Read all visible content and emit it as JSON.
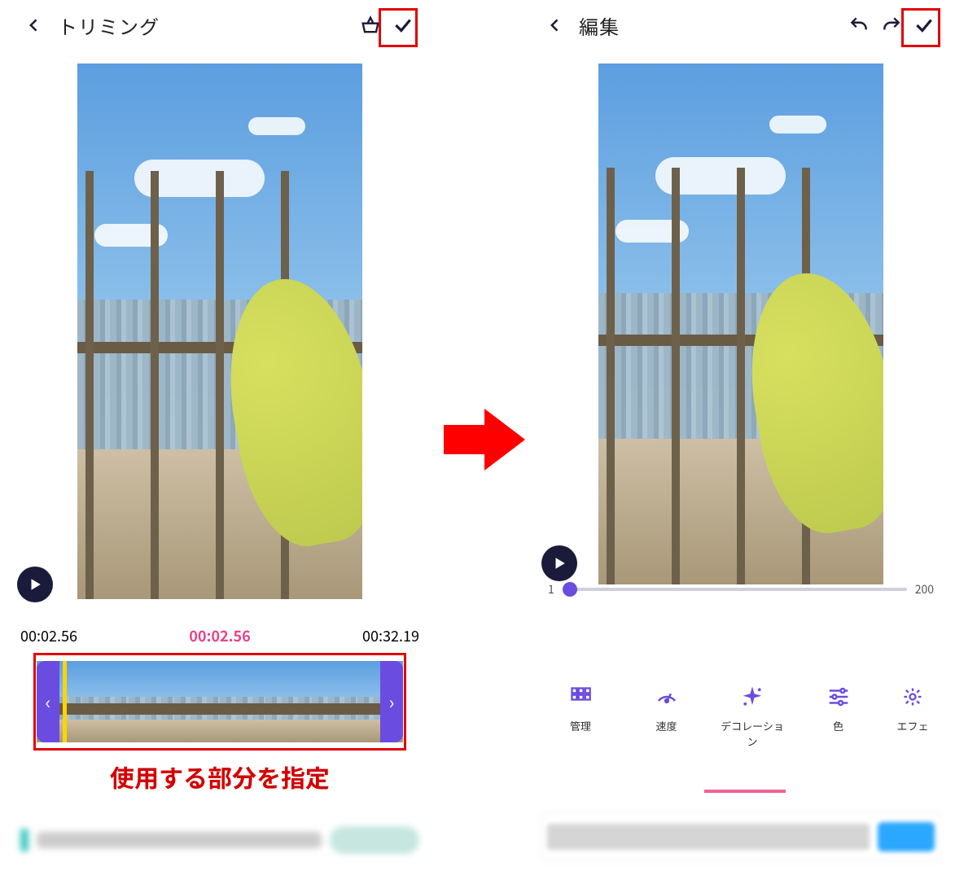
{
  "left": {
    "title": "トリミング",
    "time_start": "00:02.56",
    "time_mid": "00:02.56",
    "time_end": "00:32.19",
    "caption": "使用する部分を指定"
  },
  "right": {
    "title": "編集",
    "slider_min": "1",
    "slider_max": "200",
    "tools": [
      {
        "label": "管理"
      },
      {
        "label": "速度"
      },
      {
        "label": "デコレーション"
      },
      {
        "label": "色"
      },
      {
        "label": "エフェ"
      }
    ]
  }
}
